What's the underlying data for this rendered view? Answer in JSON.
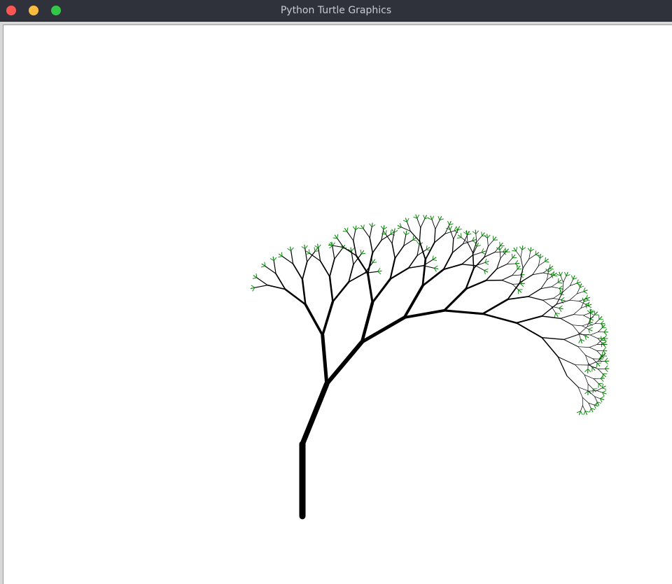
{
  "window": {
    "title": "Python Turtle Graphics",
    "buttons": [
      "close",
      "minimize",
      "maximize"
    ]
  },
  "canvas": {
    "background": "#ffffff",
    "drawing": "fractal-tree",
    "branch_color": "#000000",
    "leaf_color": "#008000"
  }
}
